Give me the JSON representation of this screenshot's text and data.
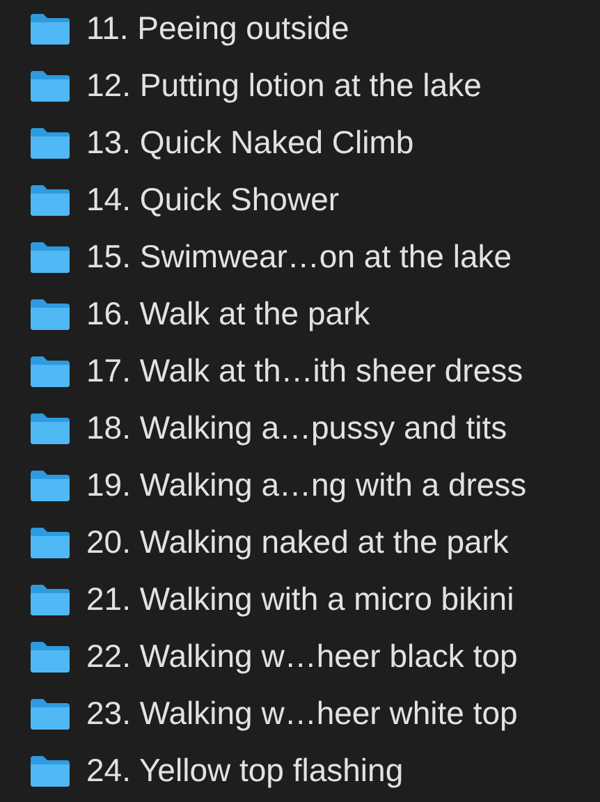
{
  "folders": [
    {
      "name": "11. Peeing outside"
    },
    {
      "name": "12. Putting lotion at the lake"
    },
    {
      "name": "13. Quick Naked Climb"
    },
    {
      "name": "14. Quick Shower"
    },
    {
      "name": "15. Swimwear…on at the lake"
    },
    {
      "name": "16. Walk at the park"
    },
    {
      "name": "17. Walk at th…ith sheer dress"
    },
    {
      "name": "18. Walking a…pussy and tits"
    },
    {
      "name": "19. Walking a…ng with a dress"
    },
    {
      "name": "20. Walking naked at the park"
    },
    {
      "name": "21. Walking with a micro bikini"
    },
    {
      "name": "22. Walking w…heer black top"
    },
    {
      "name": "23. Walking w…heer white top"
    },
    {
      "name": "24. Yellow top flashing"
    }
  ]
}
